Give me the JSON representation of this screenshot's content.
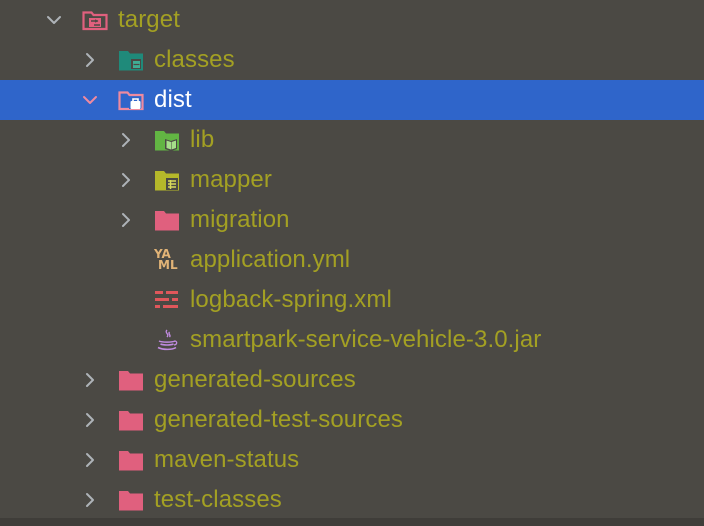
{
  "tree": {
    "items": [
      {
        "label": "target",
        "icon": "excluded-folder-icon",
        "expanded": true
      },
      {
        "label": "classes",
        "icon": "output-folder-icon",
        "expanded": false
      },
      {
        "label": "dist",
        "icon": "archive-folder-icon",
        "expanded": true,
        "selected": true
      },
      {
        "label": "lib",
        "icon": "library-folder-icon",
        "expanded": false
      },
      {
        "label": "mapper",
        "icon": "resources-folder-icon",
        "expanded": false
      },
      {
        "label": "migration",
        "icon": "folder-icon",
        "expanded": false
      },
      {
        "label": "application.yml",
        "icon": "yaml-file-icon"
      },
      {
        "label": "logback-spring.xml",
        "icon": "xml-file-icon"
      },
      {
        "label": "smartpark-service-vehicle-3.0.jar",
        "icon": "java-jar-icon"
      },
      {
        "label": "generated-sources",
        "icon": "folder-icon",
        "expanded": false
      },
      {
        "label": "generated-test-sources",
        "icon": "folder-icon",
        "expanded": false
      },
      {
        "label": "maven-status",
        "icon": "folder-icon",
        "expanded": false
      },
      {
        "label": "test-classes",
        "icon": "folder-icon",
        "expanded": false
      }
    ],
    "yaml_glyph_top": "YA",
    "yaml_glyph_bottom": "ML"
  },
  "colors": {
    "background": "#4b4944",
    "selection": "#2f65ca",
    "label": "#a3a023",
    "selected_label": "#ffffff",
    "folder_pink": "#e0607e",
    "folder_teal": "#1f8a7a",
    "folder_green": "#62b543",
    "folder_olive": "#b5b82a"
  }
}
